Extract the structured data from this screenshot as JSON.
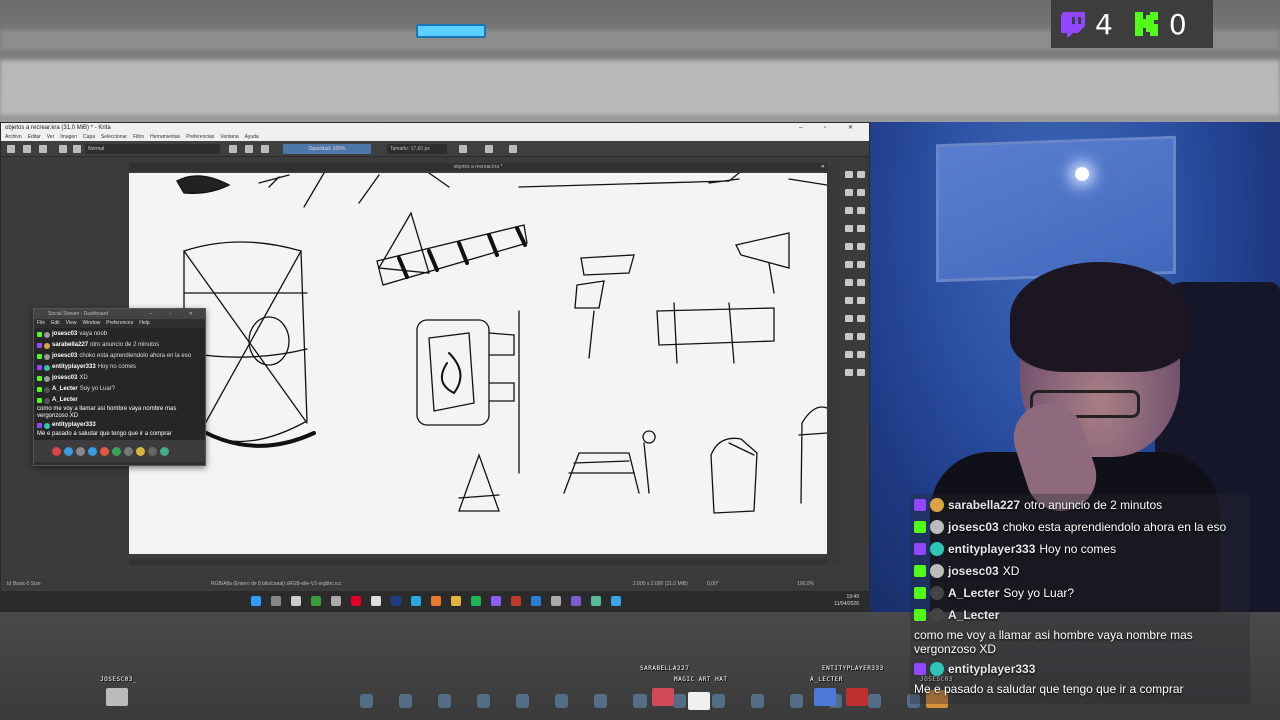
{
  "stream_counters": [
    {
      "platform": "twitch",
      "count": "4",
      "color": "#9146ff"
    },
    {
      "platform": "kick",
      "count": "0",
      "color": "#53fc18"
    }
  ],
  "krita": {
    "title": "objetos a recrear.kra (31,0 MiB) * - Krita",
    "menu": [
      "Archivo",
      "Editar",
      "Ver",
      "Imagen",
      "Capa",
      "Seleccionar",
      "Filtro",
      "Herramientas",
      "Preferencias",
      "Ventana",
      "Ayuda"
    ],
    "blend_mode": "Normal",
    "opacity": "Opacidad: 100%",
    "size": "Tamaño: 17,60 px",
    "doc_tab": "objetos a recrear.kra *",
    "status_brush": "b) Basic-5 Size",
    "status_color": "RGB/Alfa (Entero de 8 bits/canal)  sRGB-elle-V2-srgbtrc.icc",
    "status_dims": "2.000 x 2.000 (31,0 MiB)",
    "status_rot": "0,00°",
    "status_zoom": "100,0%",
    "clock_time": "19:49",
    "clock_date": "11/04/2026"
  },
  "social_stream": {
    "title": "Social Stream - Dashboard",
    "menu": [
      "File",
      "Edit",
      "View",
      "Window",
      "Preferences",
      "Help"
    ],
    "messages": [
      {
        "user": "josesc03",
        "text": "vaya noob"
      },
      {
        "user": "sarabella227",
        "text": "otro anuncio de 2 minutos"
      },
      {
        "user": "josesc03",
        "text": "choko esta aprendiendolo ahora en la eso"
      },
      {
        "user": "entityplayer333",
        "text": "Hoy no comes"
      },
      {
        "user": "josesc03",
        "text": "XD"
      },
      {
        "user": "A_Lecter",
        "text": "Soy yo Luar?"
      },
      {
        "user": "A_Lecter",
        "text": "como me voy a llamar asi hombre vaya nombre mas vergonzoso XD"
      },
      {
        "user": "entityplayer333",
        "text": "Me e pasado a saludar que tengo que ir a comprar"
      }
    ]
  },
  "overlay_chat": [
    {
      "platform": "twitch",
      "user": "sarabella227",
      "text": "otro anuncio de 2 minutos"
    },
    {
      "platform": "kick",
      "user": "josesc03",
      "text": "choko esta aprendiendolo ahora en la eso"
    },
    {
      "platform": "twitch",
      "user": "entityplayer333",
      "text": "Hoy no comes"
    },
    {
      "platform": "kick",
      "user": "josesc03",
      "text": "XD"
    },
    {
      "platform": "kick",
      "user": "A_Lecter",
      "text": "Soy yo Luar?"
    },
    {
      "platform": "kick",
      "user": "A_Lecter",
      "text": "como me voy a llamar asi hombre vaya nombre mas vergonzoso XD"
    },
    {
      "platform": "twitch",
      "user": "entityplayer333",
      "text": "Me e pasado a saludar que tengo que ir a comprar"
    }
  ],
  "avatars": [
    {
      "name": "JOSESC03_"
    },
    {
      "name": "SARABELLA227"
    },
    {
      "name": "MAGIC ART HAT"
    },
    {
      "name": "ENTITYPLAYER333"
    },
    {
      "name": "A_LECTER"
    },
    {
      "name": "JOSESC03"
    }
  ]
}
